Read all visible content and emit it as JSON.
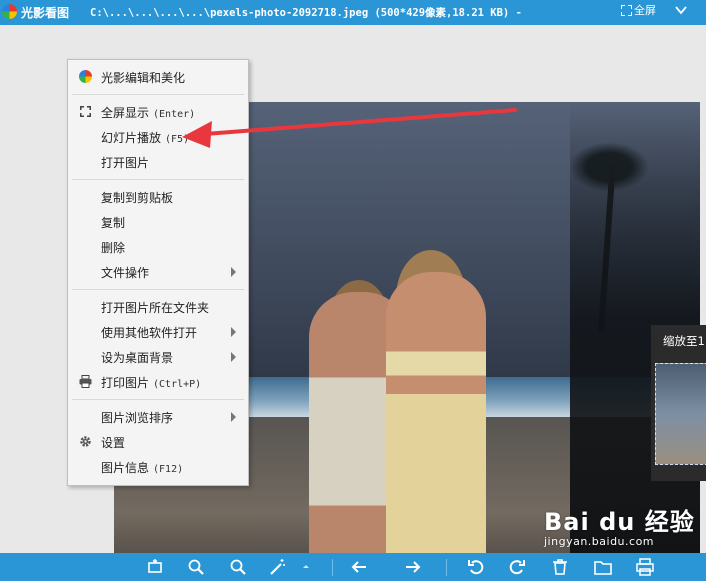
{
  "titlebar": {
    "app_name": "光影看图",
    "file_title": "C:\\...\\...\\...\\...\\pexels-photo-2092718.jpeg (500*429像素,18.21 KB) -",
    "fullscreen_label": "全屏"
  },
  "context_menu": {
    "items": [
      {
        "label": "光影编辑和美化",
        "shortcut": ""
      },
      {
        "label": "全屏显示",
        "shortcut": "(Enter)"
      },
      {
        "label": "幻灯片播放",
        "shortcut": "(F5)"
      },
      {
        "label": "打开图片",
        "shortcut": ""
      },
      {
        "label": "复制到剪贴板",
        "shortcut": ""
      },
      {
        "label": "复制",
        "shortcut": ""
      },
      {
        "label": "删除",
        "shortcut": ""
      },
      {
        "label": "文件操作",
        "shortcut": ""
      },
      {
        "label": "打开图片所在文件夹",
        "shortcut": ""
      },
      {
        "label": "使用其他软件打开",
        "shortcut": ""
      },
      {
        "label": "设为桌面背景",
        "shortcut": ""
      },
      {
        "label": "打印图片",
        "shortcut": "(Ctrl+P)"
      },
      {
        "label": "图片浏览排序",
        "shortcut": ""
      },
      {
        "label": "设置",
        "shortcut": ""
      },
      {
        "label": "图片信息",
        "shortcut": "(F12)"
      }
    ]
  },
  "thumbnail": {
    "label": "缩放至1"
  },
  "watermark": {
    "logo": "Bai du 经验",
    "url": "jingyan.baidu.com"
  },
  "colors": {
    "titlebar": "#2b96d6",
    "annotation_arrow": "#e8383d",
    "menu_bg": "#f4f4f4"
  },
  "icons": [
    "app-logo-icon",
    "fullscreen-icon",
    "menu-chevron-icon",
    "fullscreen-expand-icon",
    "printer-icon",
    "gear-icon",
    "submenu-arrow-icon"
  ]
}
